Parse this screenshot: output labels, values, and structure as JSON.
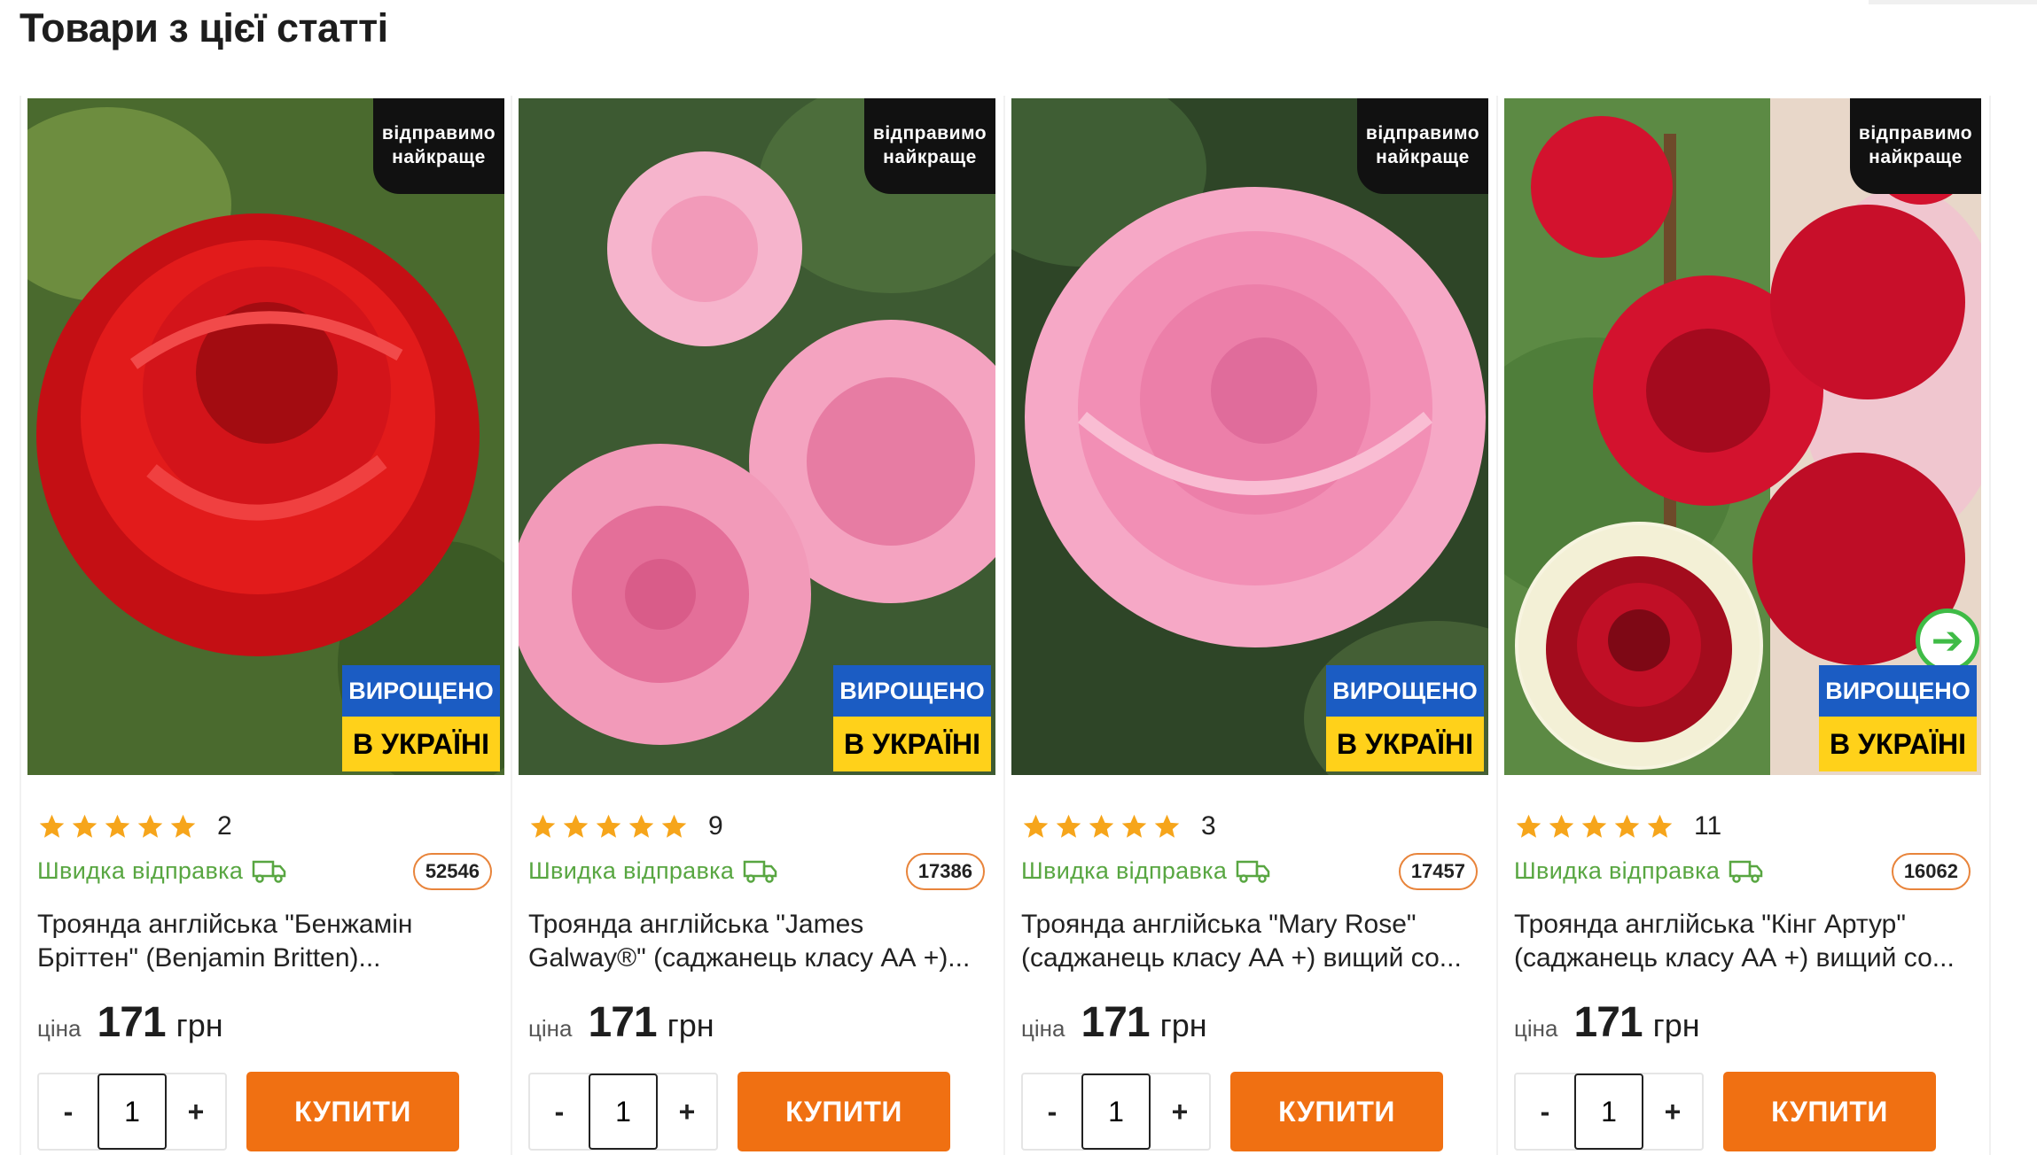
{
  "section": {
    "title": "Товари з цієї статті"
  },
  "badges": {
    "ship_line1": "відправимо",
    "ship_line2": "найкраще",
    "ua_line1": "ВИРОЩЕНО",
    "ua_line2": "В УКРАЇНІ"
  },
  "labels": {
    "fast_ship": "Швидка відправка",
    "price_label": "ціна",
    "currency": "грн",
    "buy": "КУПИТИ",
    "minus": "-",
    "plus": "+"
  },
  "products": [
    {
      "rating": 5,
      "reviews": "2",
      "code": "52546",
      "title": "Троянда англійська \"Бенжамін Бріттен\" (Benjamin Britten)...",
      "price": "171",
      "qty": "1",
      "photo_colors": [
        "#e21b1b",
        "#b80f12",
        "#5b7f3a"
      ]
    },
    {
      "rating": 5,
      "reviews": "9",
      "code": "17386",
      "title": "Троянда англійська \"James Galway®\" (саджанець класу АА +)...",
      "price": "171",
      "qty": "1",
      "photo_colors": [
        "#f29ab9",
        "#e77ca3",
        "#3d5a32"
      ]
    },
    {
      "rating": 5,
      "reviews": "3",
      "code": "17457",
      "title": "Троянда англійська \"Mary Rose\" (саджанець класу АА +) вищий со...",
      "price": "171",
      "qty": "1",
      "photo_colors": [
        "#f28fb5",
        "#e06c9b",
        "#324b2a"
      ]
    },
    {
      "rating": 5,
      "reviews": "11",
      "code": "16062",
      "title": "Троянда англійська \"Кінг Артур\" (саджанець класу АА +) вищий со...",
      "price": "171",
      "qty": "1",
      "photo_colors": [
        "#d3122e",
        "#a40a1e",
        "#4f7e3a"
      ]
    }
  ]
}
